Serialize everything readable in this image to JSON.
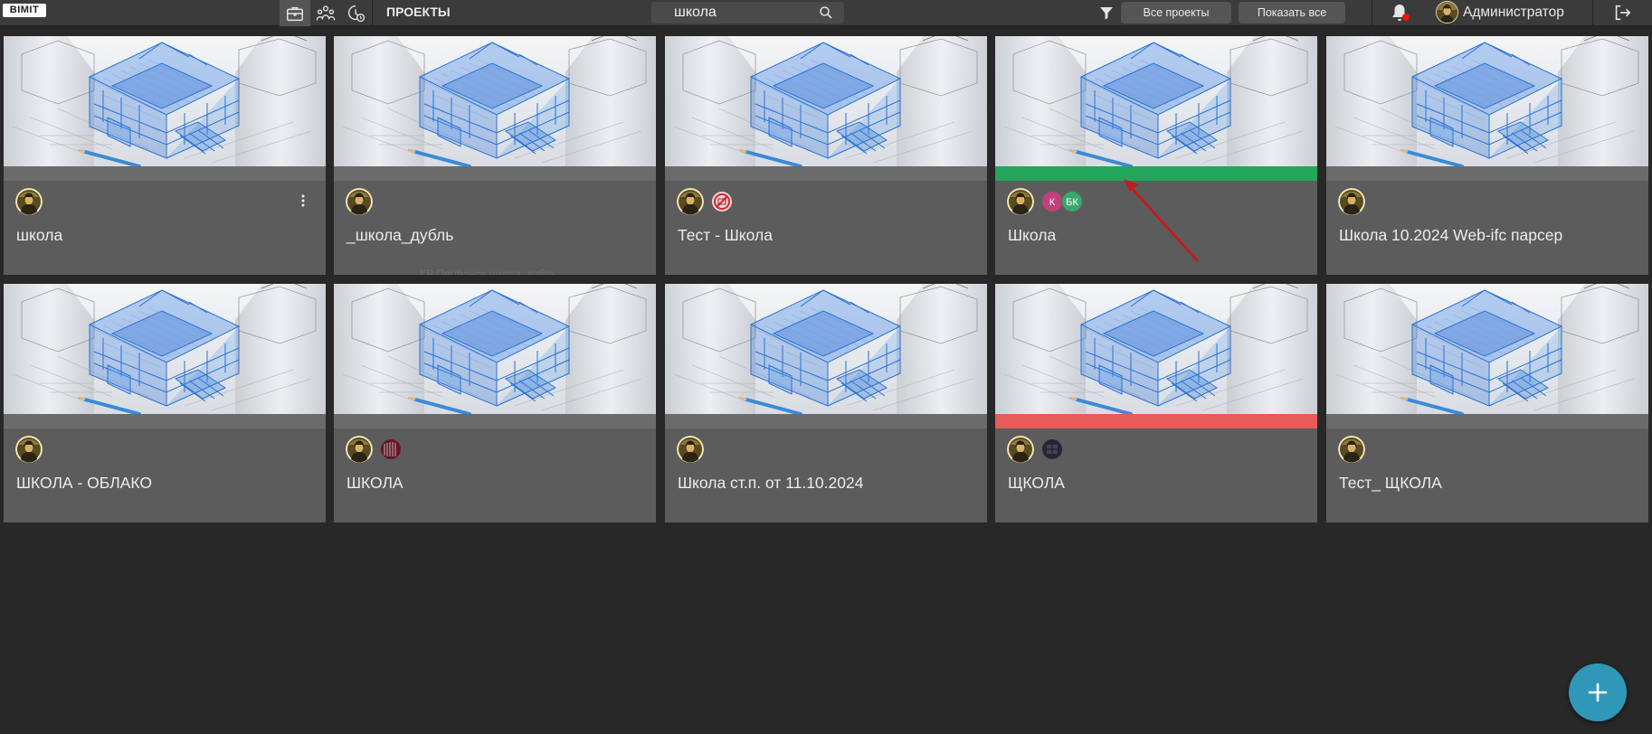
{
  "app": {
    "logo": "BIMIT",
    "section_title": "ПРОЕКТЫ"
  },
  "nav": [
    {
      "icon": "briefcase-icon",
      "active": true
    },
    {
      "icon": "users-icon",
      "active": false
    },
    {
      "icon": "clock-shield-icon",
      "active": false
    }
  ],
  "search": {
    "value": "школа",
    "icon": "search-icon"
  },
  "filters": {
    "all_projects": "Все проекты",
    "show_all": "Показать все"
  },
  "user": {
    "name": "Администратор"
  },
  "colors": {
    "topbar": "#3b3b3b",
    "card": "#5c5c5c",
    "green": "#21a65b",
    "red": "#e65a5a",
    "fab": "#2f98b8"
  },
  "projects": [
    {
      "title": "школа",
      "status": "none",
      "members": [],
      "menu": true
    },
    {
      "title": "_школа_дубль",
      "status": "none",
      "members": [],
      "ghost": "КР Пегфонок школа_дубль"
    },
    {
      "title": "Тест - Школа",
      "status": "none",
      "members": [
        "no-image"
      ]
    },
    {
      "title": "Школа",
      "status": "green",
      "members": [
        "К",
        "БК"
      ]
    },
    {
      "title": "Школа 10.2024 Web-ifc парсер",
      "status": "none",
      "members": []
    },
    {
      "title": "ШКОЛА - ОБЛАКО",
      "status": "none",
      "members": []
    },
    {
      "title": "ШКОЛА",
      "status": "none",
      "members": [
        "photo-red"
      ]
    },
    {
      "title": "Школа ст.п. от 11.10.2024",
      "status": "none",
      "members": []
    },
    {
      "title": "ЩКОЛА",
      "status": "red",
      "members": [
        "photo-dark"
      ]
    },
    {
      "title": "Тест_ ЩКОЛА",
      "status": "none",
      "members": []
    }
  ]
}
